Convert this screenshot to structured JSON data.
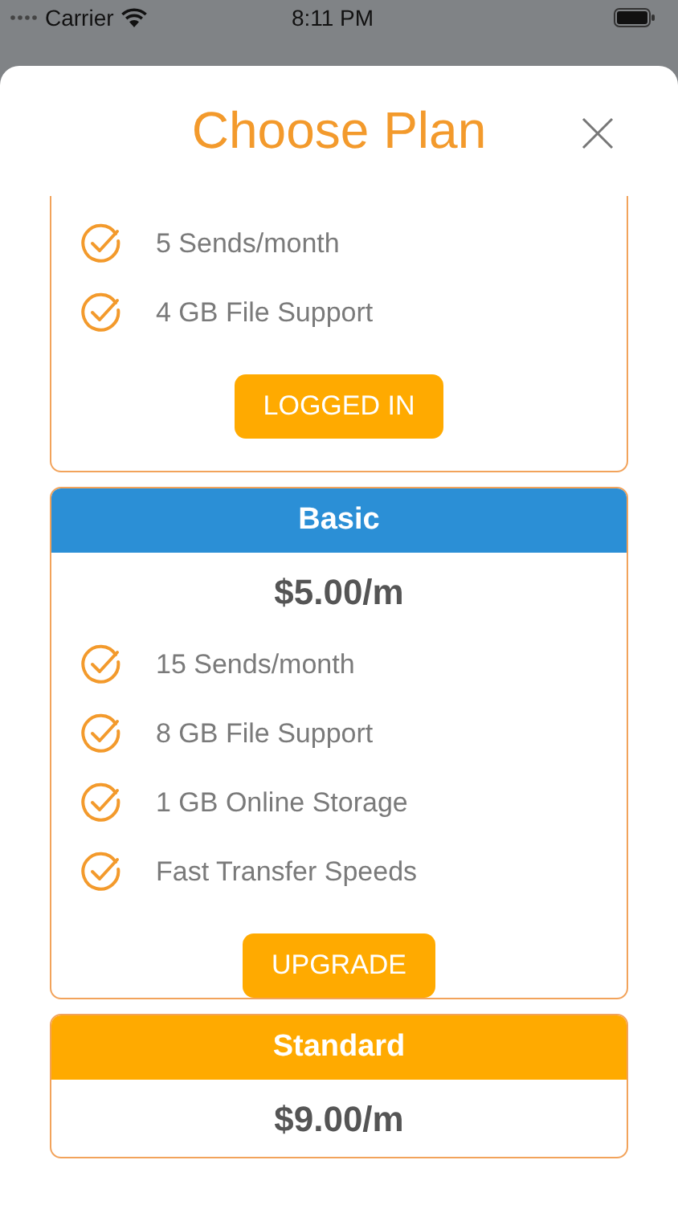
{
  "status_bar": {
    "carrier": "Carrier",
    "time": "8:11 PM"
  },
  "title": "Choose Plan",
  "plans": [
    {
      "features": [
        "5 Sends/month",
        "4 GB File Support"
      ],
      "button": "LOGGED IN"
    },
    {
      "name": "Basic",
      "color": "#2b8fd6",
      "price": "$5.00/m",
      "features": [
        "15 Sends/month",
        "8 GB File Support",
        "1 GB Online Storage",
        "Fast Transfer Speeds"
      ],
      "button": "UPGRADE"
    },
    {
      "name": "Standard",
      "color": "#ffaa00",
      "price": "$9.00/m"
    }
  ]
}
